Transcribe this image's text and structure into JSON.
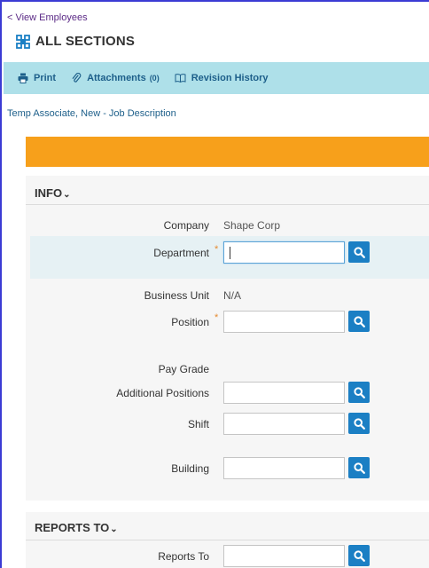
{
  "nav": {
    "back_label": "< View Employees"
  },
  "header": {
    "title": "ALL SECTIONS",
    "icon": "sections-icon"
  },
  "toolbar": {
    "print_label": "Print",
    "attachments_label": "Attachments",
    "attachments_count": "(0)",
    "revision_label": "Revision History"
  },
  "document": {
    "subtitle": "Temp Associate, New - Job Description"
  },
  "colors": {
    "toolbar_bg": "#aee0e9",
    "banner": "#f7a01b",
    "search_button": "#1b7fc4",
    "required": "#e58a2f",
    "link": "#1d5f8a"
  },
  "info": {
    "heading": "INFO",
    "company_label": "Company",
    "company_value": "Shape Corp",
    "department_label": "Department",
    "department_value": "",
    "business_unit_label": "Business Unit",
    "business_unit_value": "N/A",
    "position_label": "Position",
    "position_value": "",
    "pay_grade_label": "Pay Grade",
    "additional_positions_label": "Additional Positions",
    "additional_positions_value": "",
    "shift_label": "Shift",
    "shift_value": "",
    "building_label": "Building",
    "building_value": "",
    "required_mark": "*"
  },
  "reports": {
    "heading": "REPORTS TO",
    "reports_to_label": "Reports To",
    "reports_to_value": ""
  },
  "caret": "⌄"
}
